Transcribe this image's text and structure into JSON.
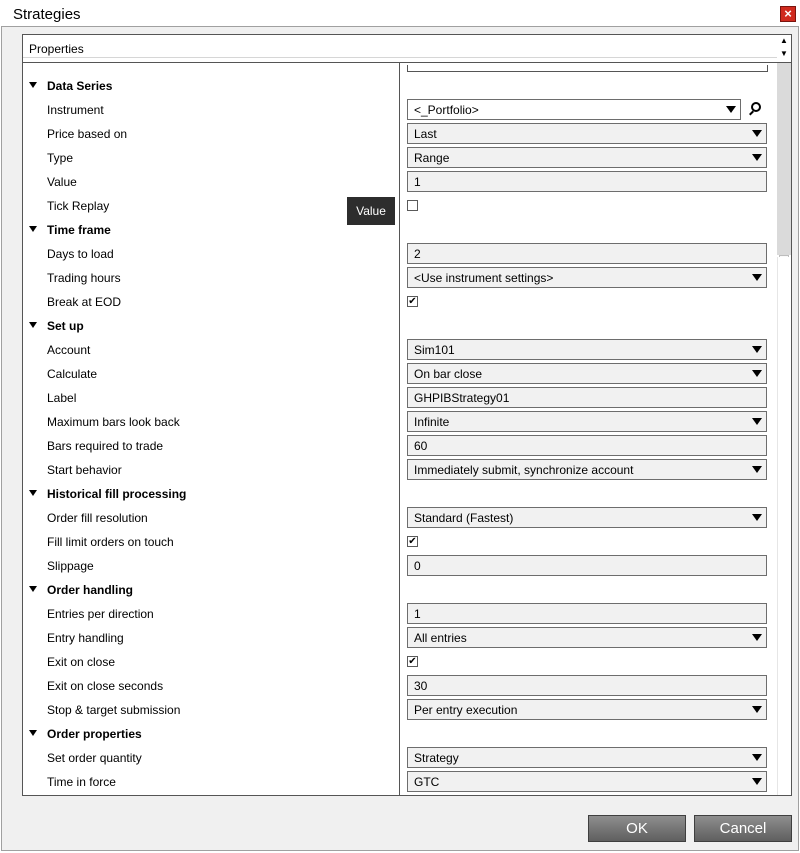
{
  "window": {
    "title": "Strategies",
    "close_glyph": "×"
  },
  "panel": {
    "title": "Properties",
    "scroll_up": "▲",
    "scroll_down": "▼"
  },
  "tooltip": "Value",
  "rows": [
    {
      "type": "category",
      "label": "Data Series"
    },
    {
      "type": "select",
      "label": "Instrument",
      "value": "<_Portfolio>",
      "search": true
    },
    {
      "type": "select",
      "label": "Price based on",
      "value": "Last"
    },
    {
      "type": "select",
      "label": "Type",
      "value": "Range"
    },
    {
      "type": "text",
      "label": "Value",
      "value": "1"
    },
    {
      "type": "checkbox",
      "label": "Tick Replay",
      "checked": false
    },
    {
      "type": "category",
      "label": "Time frame"
    },
    {
      "type": "text",
      "label": "Days to load",
      "value": "2"
    },
    {
      "type": "select",
      "label": "Trading hours",
      "value": "<Use instrument settings>"
    },
    {
      "type": "checkbox",
      "label": "Break at EOD",
      "checked": true
    },
    {
      "type": "category",
      "label": "Set up"
    },
    {
      "type": "select",
      "label": "Account",
      "value": "Sim101"
    },
    {
      "type": "select",
      "label": "Calculate",
      "value": "On bar close"
    },
    {
      "type": "text",
      "label": "Label",
      "value": "GHPIBStrategy01"
    },
    {
      "type": "select",
      "label": "Maximum bars look back",
      "value": "Infinite"
    },
    {
      "type": "text",
      "label": "Bars required to trade",
      "value": "60"
    },
    {
      "type": "select",
      "label": "Start behavior",
      "value": "Immediately submit, synchronize account"
    },
    {
      "type": "category",
      "label": "Historical fill processing"
    },
    {
      "type": "select",
      "label": "Order fill resolution",
      "value": "Standard (Fastest)"
    },
    {
      "type": "checkbox",
      "label": "Fill limit orders on touch",
      "checked": true
    },
    {
      "type": "text",
      "label": "Slippage",
      "value": "0"
    },
    {
      "type": "category",
      "label": "Order handling"
    },
    {
      "type": "text",
      "label": "Entries per direction",
      "value": "1"
    },
    {
      "type": "select",
      "label": "Entry handling",
      "value": "All entries"
    },
    {
      "type": "checkbox",
      "label": "Exit on close",
      "checked": true
    },
    {
      "type": "text",
      "label": "Exit on close seconds",
      "value": "30"
    },
    {
      "type": "select",
      "label": "Stop & target submission",
      "value": "Per entry execution"
    },
    {
      "type": "category",
      "label": "Order properties"
    },
    {
      "type": "select",
      "label": "Set order quantity",
      "value": "Strategy"
    },
    {
      "type": "select",
      "label": "Time in force",
      "value": "GTC"
    }
  ],
  "buttons": {
    "ok": "OK",
    "cancel": "Cancel"
  },
  "colors": {
    "button_top": "#8e8e8e",
    "button_bottom": "#5f5f5f",
    "close_red": "#d02a1e",
    "field_bg": "#f1f1f1",
    "tooltip_bg": "#2d2d2d"
  }
}
